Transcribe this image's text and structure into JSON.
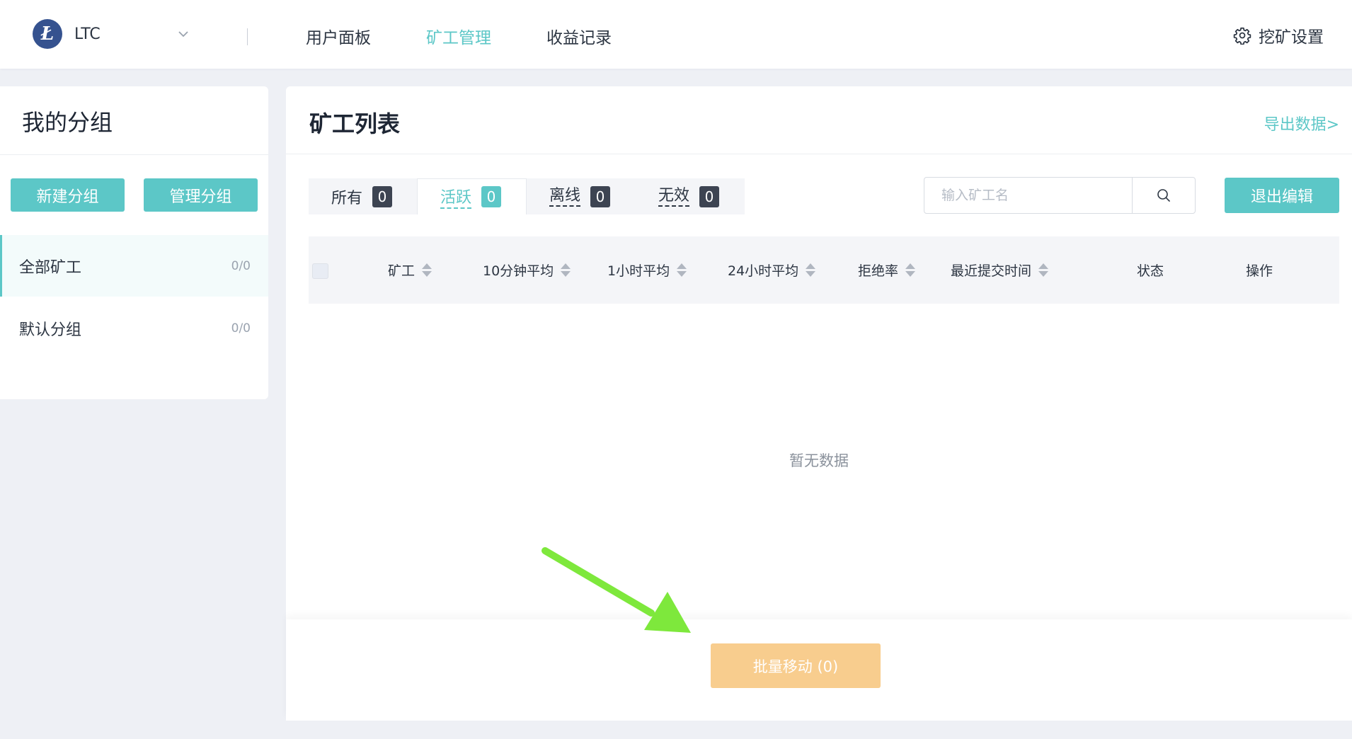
{
  "header": {
    "coin_symbol": "LTC",
    "coin_logo_glyph": "Ł",
    "nav": [
      {
        "label": "用户面板",
        "active": false
      },
      {
        "label": "矿工管理",
        "active": true
      },
      {
        "label": "收益记录",
        "active": false
      }
    ],
    "settings_label": "挖矿设置"
  },
  "sidebar": {
    "title": "我的分组",
    "new_group_label": "新建分组",
    "manage_group_label": "管理分组",
    "items": [
      {
        "label": "全部矿工",
        "count": "0/0",
        "active": true
      },
      {
        "label": "默认分组",
        "count": "0/0",
        "active": false
      }
    ]
  },
  "main": {
    "title": "矿工列表",
    "export_label": "导出数据>",
    "tabs": [
      {
        "label": "所有",
        "count": "0",
        "active": false
      },
      {
        "label": "活跃",
        "count": "0",
        "active": true
      },
      {
        "label": "离线",
        "count": "0",
        "active": false
      },
      {
        "label": "无效",
        "count": "0",
        "active": false
      }
    ],
    "search_placeholder": "输入矿工名",
    "exit_edit_label": "退出编辑",
    "columns": [
      "矿工",
      "10分钟平均",
      "1小时平均",
      "24小时平均",
      "拒绝率",
      "最近提交时间",
      "状态",
      "操作"
    ],
    "empty_text": "暂无数据",
    "batch_move_label": "批量移动 (0)"
  },
  "colors": {
    "accent": "#5cc7c7",
    "batch_button": "#f8cd8e",
    "badge": "#3d4452",
    "annotation_arrow": "#7ee83c"
  },
  "icons": [
    "litecoin-logo-icon",
    "chevron-down-icon",
    "gear-icon",
    "search-icon",
    "sort-icon",
    "arrow-annotation"
  ]
}
